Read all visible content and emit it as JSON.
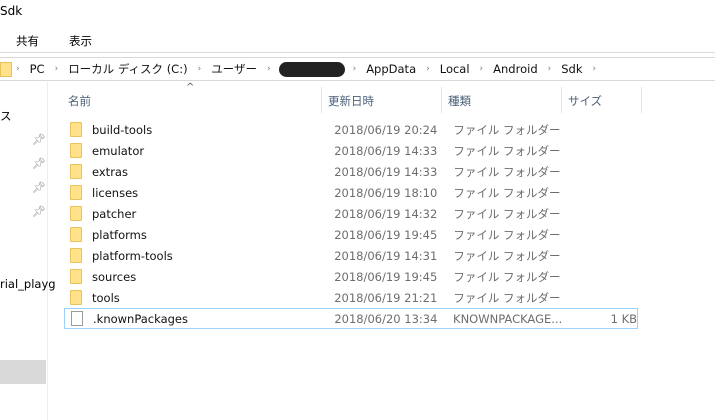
{
  "window": {
    "title": "Sdk"
  },
  "ribbon": {
    "tabs": [
      "共有",
      "表示"
    ]
  },
  "address": {
    "crumbs": [
      "PC",
      "ローカル ディスク (C:)",
      "ユーザー",
      "AppData",
      "Local",
      "Android",
      "Sdk"
    ]
  },
  "nav": {
    "partial_label_1": "ス",
    "partial_label_2": "rial_playg"
  },
  "columns": {
    "name": "名前",
    "date": "更新日時",
    "type": "種類",
    "size": "サイズ"
  },
  "files": [
    {
      "name": "build-tools",
      "date": "2018/06/19 20:24",
      "type": "ファイル フォルダー",
      "size": "",
      "kind": "folder"
    },
    {
      "name": "emulator",
      "date": "2018/06/19 14:33",
      "type": "ファイル フォルダー",
      "size": "",
      "kind": "folder"
    },
    {
      "name": "extras",
      "date": "2018/06/19 14:33",
      "type": "ファイル フォルダー",
      "size": "",
      "kind": "folder"
    },
    {
      "name": "licenses",
      "date": "2018/06/19 18:10",
      "type": "ファイル フォルダー",
      "size": "",
      "kind": "folder"
    },
    {
      "name": "patcher",
      "date": "2018/06/19 14:32",
      "type": "ファイル フォルダー",
      "size": "",
      "kind": "folder"
    },
    {
      "name": "platforms",
      "date": "2018/06/19 19:45",
      "type": "ファイル フォルダー",
      "size": "",
      "kind": "folder"
    },
    {
      "name": "platform-tools",
      "date": "2018/06/19 14:31",
      "type": "ファイル フォルダー",
      "size": "",
      "kind": "folder"
    },
    {
      "name": "sources",
      "date": "2018/06/19 19:45",
      "type": "ファイル フォルダー",
      "size": "",
      "kind": "folder"
    },
    {
      "name": "tools",
      "date": "2018/06/19 21:21",
      "type": "ファイル フォルダー",
      "size": "",
      "kind": "folder"
    },
    {
      "name": ".knownPackages",
      "date": "2018/06/20 13:34",
      "type": "KNOWNPACKAGE...",
      "size": "1 KB",
      "kind": "file"
    }
  ]
}
